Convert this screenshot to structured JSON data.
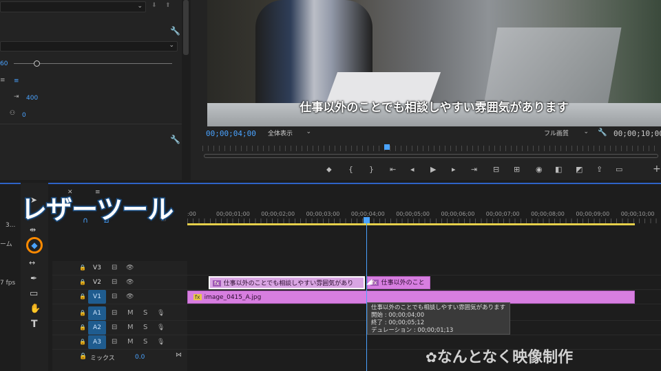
{
  "left_panel": {
    "value_60": "60",
    "value_400": "400",
    "value_0": "0",
    "truncated_label_3": "3...",
    "truncated_label_frame": "ーム",
    "truncated_label_fps": "7 fps"
  },
  "monitor": {
    "subtitle": "仕事以外のことでも相談しやすい雰囲気があります",
    "current_timecode": "00;00;04;00",
    "zoom_select": "全体表示",
    "quality_select": "フル画質",
    "duration_timecode": "00;00;10;00"
  },
  "overlay": {
    "title": "レザーツール",
    "watermark": "なんとなく映像制作"
  },
  "timeline": {
    "ruler_ticks": [
      "00;00;01;00",
      "00;00;02;00",
      "00;00;03;00",
      "00;00;04;00",
      "00;00;05;00",
      "00;00;06;00",
      "00;00;07;00",
      "00;00;08;00",
      "00;00;09;00",
      "00;00;10;00"
    ],
    "ruler_start": ":00",
    "tracks": [
      {
        "name": "V3",
        "active": false
      },
      {
        "name": "V2",
        "active": false
      },
      {
        "name": "V1",
        "active": true
      },
      {
        "name": "A1",
        "active": true
      },
      {
        "name": "A2",
        "active": true
      },
      {
        "name": "A3",
        "active": true
      }
    ],
    "mix_label": "ミックス",
    "mix_value": "0.0",
    "clips": {
      "v2_left": "仕事以外のことでも相談しやすい雰囲気があり",
      "v2_right": "仕事以外のこと",
      "v1": "image_0415_A.jpg",
      "fx": "fx"
    },
    "tooltip": {
      "title": "仕事以外のことでも相談しやすい雰囲気があります",
      "start": "開始 : 00;00;04;00",
      "end": "終了 : 00;00;05;12",
      "duration": "デュレーション : 00;00;01;13"
    },
    "audio_letters": {
      "m": "M",
      "s": "S"
    }
  },
  "colors": {
    "accent": "#2e63c7",
    "clip": "#d77ee0",
    "playhead": "#4aa3ff",
    "tool_highlight": "#ff8a00"
  }
}
